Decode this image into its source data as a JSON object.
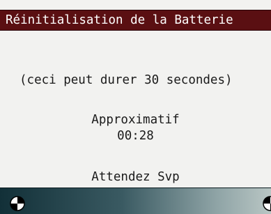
{
  "title_bar": {
    "title": "Réinitialisation de la Batterie"
  },
  "content": {
    "note": "(ceci peut durer 30 secondes)",
    "approx_label": "Approximatif",
    "timer": "00:28",
    "wait_label": "Attendez Svp"
  },
  "footer": {
    "left_icon": "scroll-left-dial-icon",
    "right_icon": "scroll-right-dial-icon"
  },
  "colors": {
    "title_bg": "#5a0f12",
    "title_text": "#ffffff",
    "screen_bg": "#f2f2f0",
    "footer_gradient_start": "#123038",
    "footer_gradient_end": "#b9c6c4"
  }
}
